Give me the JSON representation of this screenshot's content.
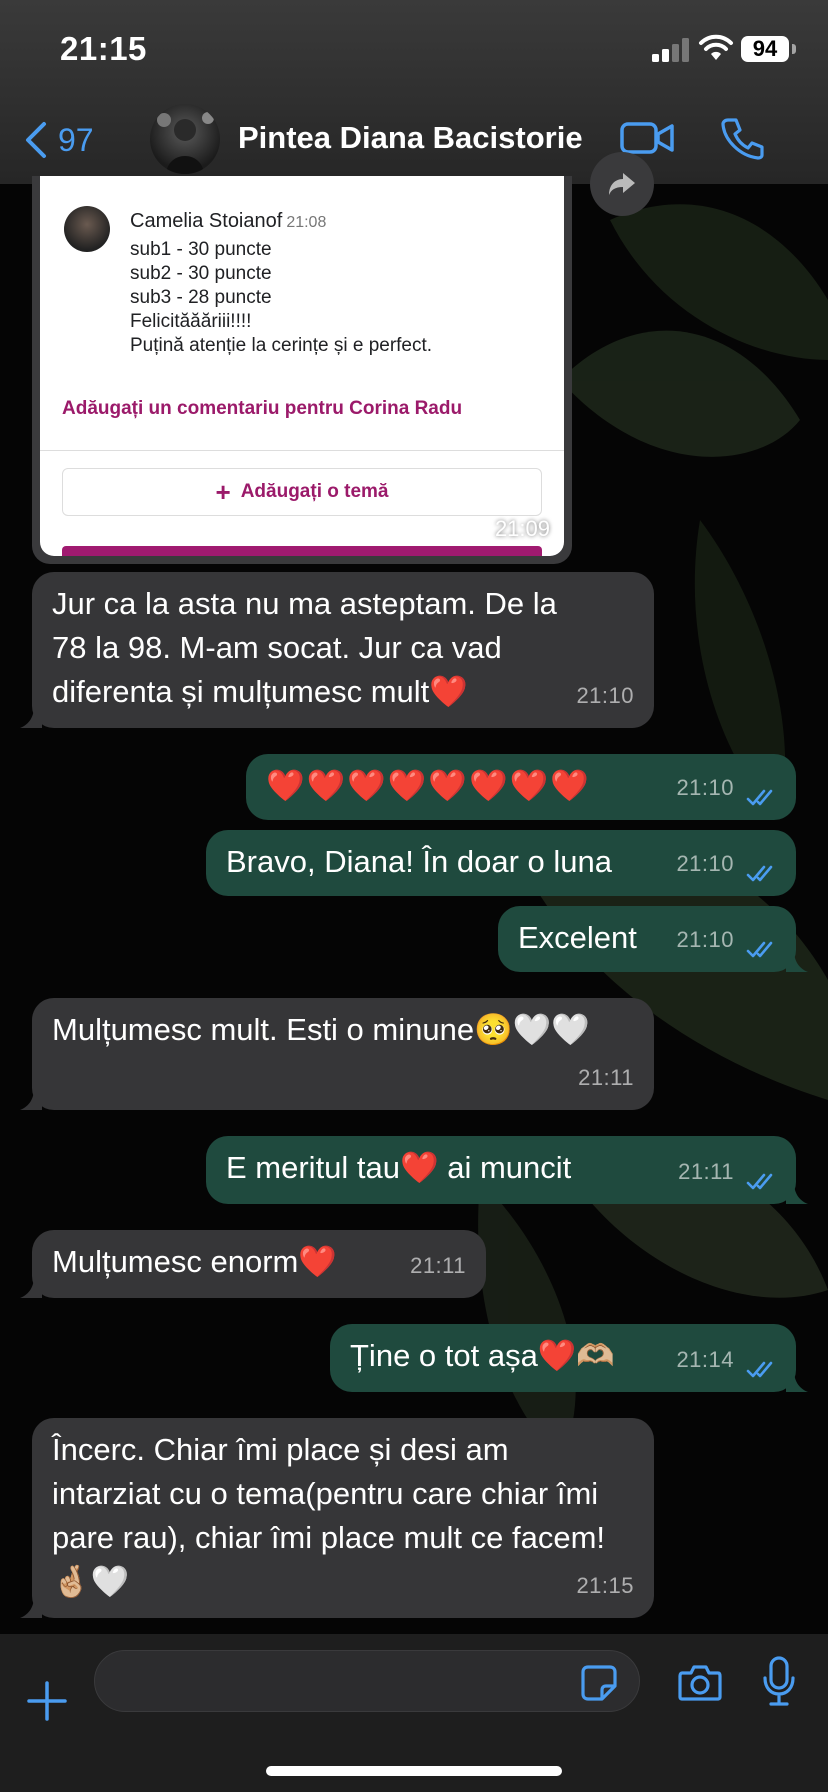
{
  "status_bar": {
    "time": "21:15",
    "battery": "94"
  },
  "header": {
    "back_count": "97",
    "contact_name": "Pintea Diana Bacistorie"
  },
  "shared_image": {
    "commenter_name": "Camelia Stoianof",
    "comment_time": "21:08",
    "comment_lines": [
      "sub1 -  30 puncte",
      "sub2 - 30 puncte",
      "sub3 - 28 puncte",
      "Felicităăăriii!!!!",
      "Puțină atenție la cerințe și e perfect."
    ],
    "add_comment_label": "Adăugați un comentariu pentru Corina Radu",
    "add_topic_label": "Adăugați o temă",
    "time": "21:09"
  },
  "messages": [
    {
      "direction": "in",
      "text": "Jur ca la asta nu ma asteptam. De la 78 la 98. M-am socat. Jur ca vad diferenta și mulțumesc mult❤️",
      "time": "21:10"
    },
    {
      "direction": "out",
      "text": "❤️❤️❤️❤️❤️❤️❤️❤️",
      "time": "21:10",
      "read": true
    },
    {
      "direction": "out",
      "text": "Bravo, Diana! În doar o luna",
      "time": "21:10",
      "read": true
    },
    {
      "direction": "out",
      "text": "Excelent",
      "time": "21:10",
      "read": true
    },
    {
      "direction": "in",
      "text": "Mulțumesc mult. Esti o minune🥺🤍🤍",
      "time": "21:11"
    },
    {
      "direction": "out",
      "text": "E meritul tau❤️ ai muncit",
      "time": "21:11",
      "read": true
    },
    {
      "direction": "in",
      "text": "Mulțumesc enorm❤️",
      "time": "21:11"
    },
    {
      "direction": "out",
      "text": "Ține o tot așa❤️🫶🏼",
      "time": "21:14",
      "read": true
    },
    {
      "direction": "in",
      "text": "Încerc. Chiar îmi place și desi am intarziat cu o tema(pentru care chiar îmi pare rau), chiar îmi place mult ce facem!🤞🏼🤍",
      "time": "21:15"
    }
  ],
  "composer": {
    "input_value": ""
  },
  "colors": {
    "accent": "#4a9cf0",
    "incoming": "#363638",
    "outgoing": "#1f4a3e",
    "brand_purple": "#9b1a6a"
  }
}
